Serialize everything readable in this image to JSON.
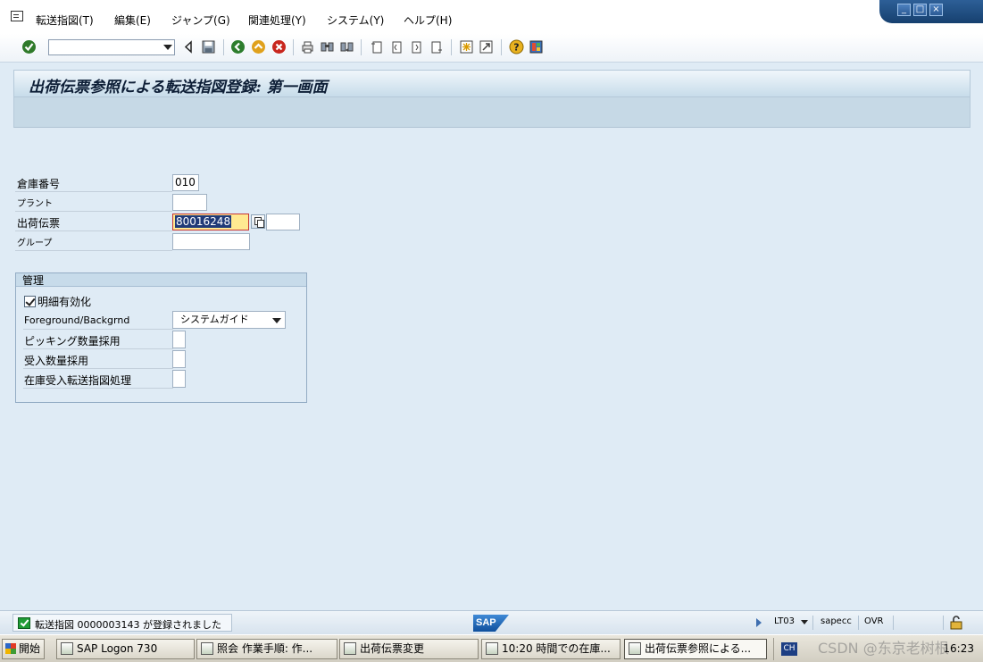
{
  "menu": {
    "items": [
      "転送指図(T)",
      "編集(E)",
      "ジャンプ(G)",
      "関連処理(Y)",
      "システム(Y)",
      "ヘルプ(H)"
    ]
  },
  "window": {
    "controls": [
      "_",
      "□",
      "×"
    ]
  },
  "toolbar": {
    "command_value": ""
  },
  "screen": {
    "title": "出荷伝票参照による転送指図登録: 第一画面"
  },
  "form": {
    "fields": [
      {
        "label": "倉庫番号",
        "value": "010"
      },
      {
        "label": "プラント",
        "value": ""
      },
      {
        "label": "出荷伝票",
        "value": "80016248",
        "value2": ""
      },
      {
        "label": "グループ",
        "value": ""
      }
    ]
  },
  "group": {
    "title": "管理",
    "checkbox_label": "明細有効化",
    "checkbox_checked": true,
    "rows": [
      {
        "label": "Foreground/Backgrnd",
        "value": "システムガイド"
      },
      {
        "label": "ピッキング数量採用",
        "value": ""
      },
      {
        "label": "受入数量採用",
        "value": ""
      },
      {
        "label": "在庫受入転送指図処理",
        "value": ""
      }
    ]
  },
  "status": {
    "message": "転送指図 0000003143 が登録されました",
    "logo": "SAP",
    "transaction": "LT03",
    "server": "sapecc",
    "mode": "OVR"
  },
  "taskbar": {
    "start": "開始",
    "tasks": [
      "SAP Logon 730",
      "照会 作業手順: 作...",
      "出荷伝票変更",
      "10:20 時間での在庫...",
      "出荷伝票参照による..."
    ],
    "lang": "CH",
    "clock": "16:23"
  },
  "watermark": "CSDN @东京老树根",
  "colors": {
    "background": "#dfebf5",
    "title_band": "#c7dcea",
    "selection": "#203a78",
    "highlight_field": "#ffe991"
  }
}
